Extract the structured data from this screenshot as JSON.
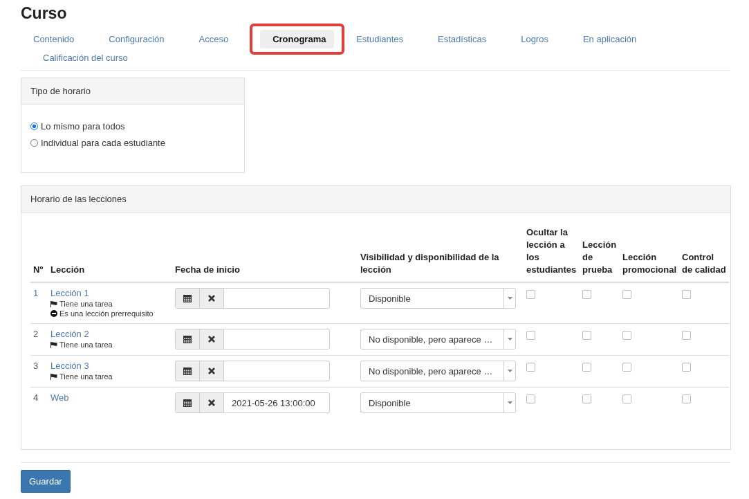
{
  "page_title": "Curso",
  "tabs": [
    {
      "label": "Contenido",
      "selected": false,
      "highlighted": false
    },
    {
      "label": "Configuración",
      "selected": false,
      "highlighted": false
    },
    {
      "label": "Acceso",
      "selected": false,
      "highlighted": false
    },
    {
      "label": "Cronograma",
      "selected": true,
      "highlighted": true
    },
    {
      "label": "Estudiantes",
      "selected": false,
      "highlighted": false
    },
    {
      "label": "Estadísticas",
      "selected": false,
      "highlighted": false
    },
    {
      "label": "Logros",
      "selected": false,
      "highlighted": false
    },
    {
      "label": "En aplicación",
      "selected": false,
      "highlighted": false
    },
    {
      "label": "Calificación del curso",
      "selected": false,
      "highlighted": false
    }
  ],
  "schedule_type": {
    "title": "Tipo de horario",
    "options": [
      {
        "label": "Lo mismo para todos",
        "selected": true
      },
      {
        "label": "Individual para cada estudiante",
        "selected": false
      }
    ]
  },
  "lessons_schedule": {
    "title": "Horario de las lecciones",
    "columns": [
      "Nº",
      "Lección",
      "Fecha de inicio",
      "Visibilidad y disponibilidad de la lección",
      "Ocultar la lección a los estudiantes",
      "Lección de prueba",
      "Lección promocional",
      "Control de calidad"
    ],
    "rows": [
      {
        "number": "1",
        "lesson": "Lección 1",
        "notes": [
          {
            "kind": "task",
            "text": "Tiene una tarea"
          },
          {
            "kind": "prerequisite",
            "text": "Es una lección prerrequisito"
          }
        ],
        "start_date": "",
        "visibility": "Disponible",
        "hide": false,
        "trial": false,
        "promo": false,
        "quality": false
      },
      {
        "number": "2",
        "lesson": "Lección 2",
        "notes": [
          {
            "kind": "task",
            "text": "Tiene una tarea"
          }
        ],
        "start_date": "",
        "visibility": "No disponible, pero aparece …",
        "hide": false,
        "trial": false,
        "promo": false,
        "quality": false
      },
      {
        "number": "3",
        "lesson": "Lección 3",
        "notes": [
          {
            "kind": "task",
            "text": "Tiene una tarea"
          }
        ],
        "start_date": "",
        "visibility": "No disponible, pero aparece …",
        "hide": false,
        "trial": false,
        "promo": false,
        "quality": false
      },
      {
        "number": "4",
        "lesson": "Web",
        "notes": [],
        "start_date": "2021-05-26 13:00:00",
        "visibility": "Disponible",
        "hide": false,
        "trial": false,
        "promo": false,
        "quality": false
      }
    ]
  },
  "save_button": "Guardar"
}
